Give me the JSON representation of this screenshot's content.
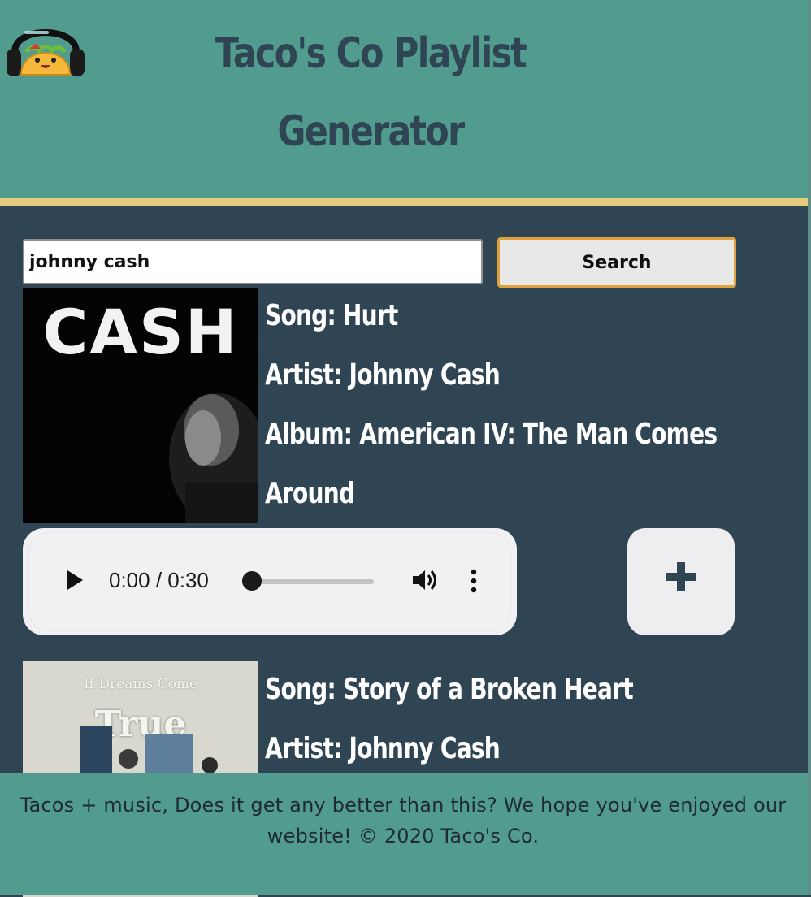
{
  "header": {
    "title": "Taco's Co Playlist Generator",
    "logo_icon": "taco-headphones-logo"
  },
  "search": {
    "value": "johnny cash",
    "button_label": "Search"
  },
  "results": [
    {
      "album_art_text": "CASH",
      "song": "Song: Hurt",
      "artist": "Artist: Johnny Cash",
      "album_line1": "Album:  American  IV:  The  Man  Comes",
      "album_line2": "Around",
      "player": {
        "time": "0:00 / 0:30",
        "progress": 0.0
      },
      "add_icon": "plus-icon"
    },
    {
      "album_art_text_top": "If Dreams Come",
      "album_art_text_big": "True",
      "song": "Song: Story of a Broken Heart",
      "artist": "Artist: Johnny Cash"
    }
  ],
  "footer": {
    "text": "Tacos + music, Does it get any better than this? We hope you've enjoyed our website! © 2020 Taco's Co."
  },
  "colors": {
    "header_bg": "#519c8e",
    "page_bg": "#2f4553",
    "accent_rule": "#e8cc7e",
    "search_button_border": "#e0a23b"
  }
}
